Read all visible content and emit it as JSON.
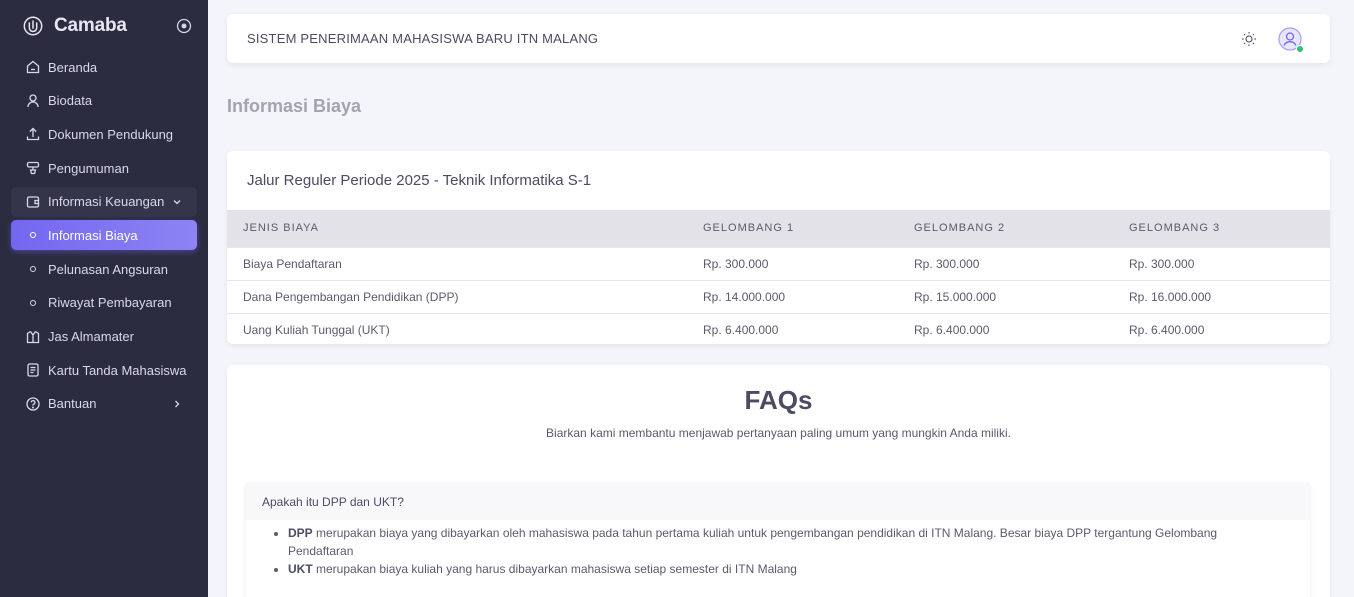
{
  "sidebar": {
    "brand": "Camaba",
    "items": [
      {
        "label": "Beranda",
        "icon": "home-icon"
      },
      {
        "label": "Biodata",
        "icon": "user-icon"
      },
      {
        "label": "Dokumen Pendukung",
        "icon": "upload-icon"
      },
      {
        "label": "Pengumuman",
        "icon": "announcement-icon"
      },
      {
        "label": "Informasi Keuangan",
        "icon": "wallet-icon"
      },
      {
        "label": "Informasi Biaya",
        "icon": "circle-icon"
      },
      {
        "label": "Pelunasan Angsuran",
        "icon": "circle-icon"
      },
      {
        "label": "Riwayat Pembayaran",
        "icon": "circle-icon"
      },
      {
        "label": "Jas Almamater",
        "icon": "jacket-icon"
      },
      {
        "label": "Kartu Tanda Mahasiswa",
        "icon": "id-card-icon"
      },
      {
        "label": "Bantuan",
        "icon": "help-icon"
      }
    ]
  },
  "navbar": {
    "title": "SISTEM PENERIMAAN MAHASISWA BARU ITN MALANG"
  },
  "page_title": "Informasi Biaya",
  "fee_card": {
    "title": "Jalur Reguler Periode 2025 - Teknik Informatika S-1",
    "columns": [
      "JENIS BIAYA",
      "GELOMBANG 1",
      "GELOMBANG 2",
      "GELOMBANG 3"
    ],
    "rows": [
      [
        "Biaya Pendaftaran",
        "Rp. 300.000",
        "Rp. 300.000",
        "Rp. 300.000"
      ],
      [
        "Dana Pengembangan Pendidikan (DPP)",
        "Rp. 14.000.000",
        "Rp. 15.000.000",
        "Rp. 16.000.000"
      ],
      [
        "Uang Kuliah Tunggal (UKT)",
        "Rp. 6.400.000",
        "Rp. 6.400.000",
        "Rp. 6.400.000"
      ]
    ]
  },
  "faq": {
    "title": "FAQs",
    "subtitle": "Biarkan kami membantu menjawab pertanyaan paling umum yang mungkin Anda miliki.",
    "question": "Apakah itu DPP dan UKT?",
    "answers": [
      {
        "term": "DPP",
        "text": "merupakan biaya yang dibayarkan oleh mahasiswa pada tahun pertama kuliah untuk pengembangan pendidikan di ITN Malang. Besar biaya DPP tergantung Gelombang Pendaftaran"
      },
      {
        "term": "UKT",
        "text": "merupakan biaya kuliah yang harus dibayarkan mahasiswa setiap semester di ITN Malang"
      }
    ]
  },
  "colors": {
    "sidebar_bg": "#2b2c40",
    "accent": "#7367f0",
    "online": "#28c76f"
  }
}
